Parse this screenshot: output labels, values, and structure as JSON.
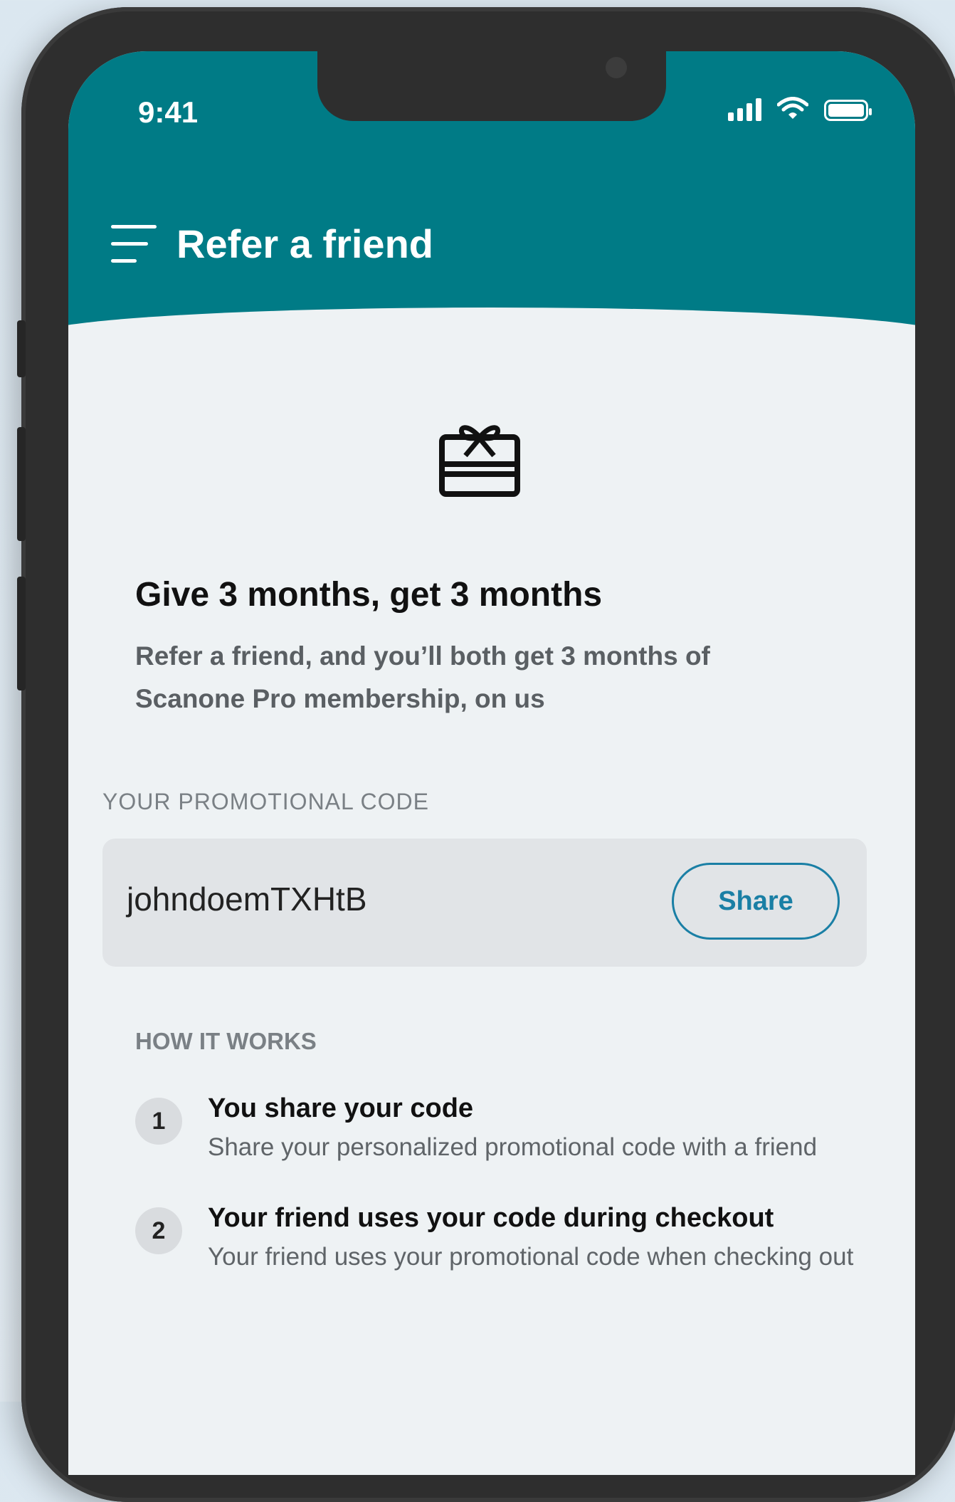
{
  "status_bar": {
    "time": "9:41"
  },
  "header": {
    "title": "Refer a friend"
  },
  "promo": {
    "headline": "Give 3 months, get 3 months",
    "description": "Refer a friend, and you’ll both get 3 months of Scanone Pro membership, on us"
  },
  "code_section": {
    "label": "YOUR PROMOTIONAL CODE",
    "code": "johndoemTXHtB",
    "share_label": "Share"
  },
  "how_it_works": {
    "label": "HOW IT WORKS",
    "steps": [
      {
        "number": "1",
        "title": "You share your code",
        "description": "Share your personalized promotional code with a friend"
      },
      {
        "number": "2",
        "title": "Your friend uses your code during checkout",
        "description": "Your friend uses your promotional code when checking out"
      }
    ]
  },
  "colors": {
    "header": "#007b86",
    "accent": "#1a7fa5",
    "background": "#eef2f4"
  },
  "icons": {
    "menu": "menu-icon",
    "gift": "gift-card-icon",
    "signal": "signal-icon",
    "wifi": "wifi-icon",
    "battery": "battery-icon"
  }
}
